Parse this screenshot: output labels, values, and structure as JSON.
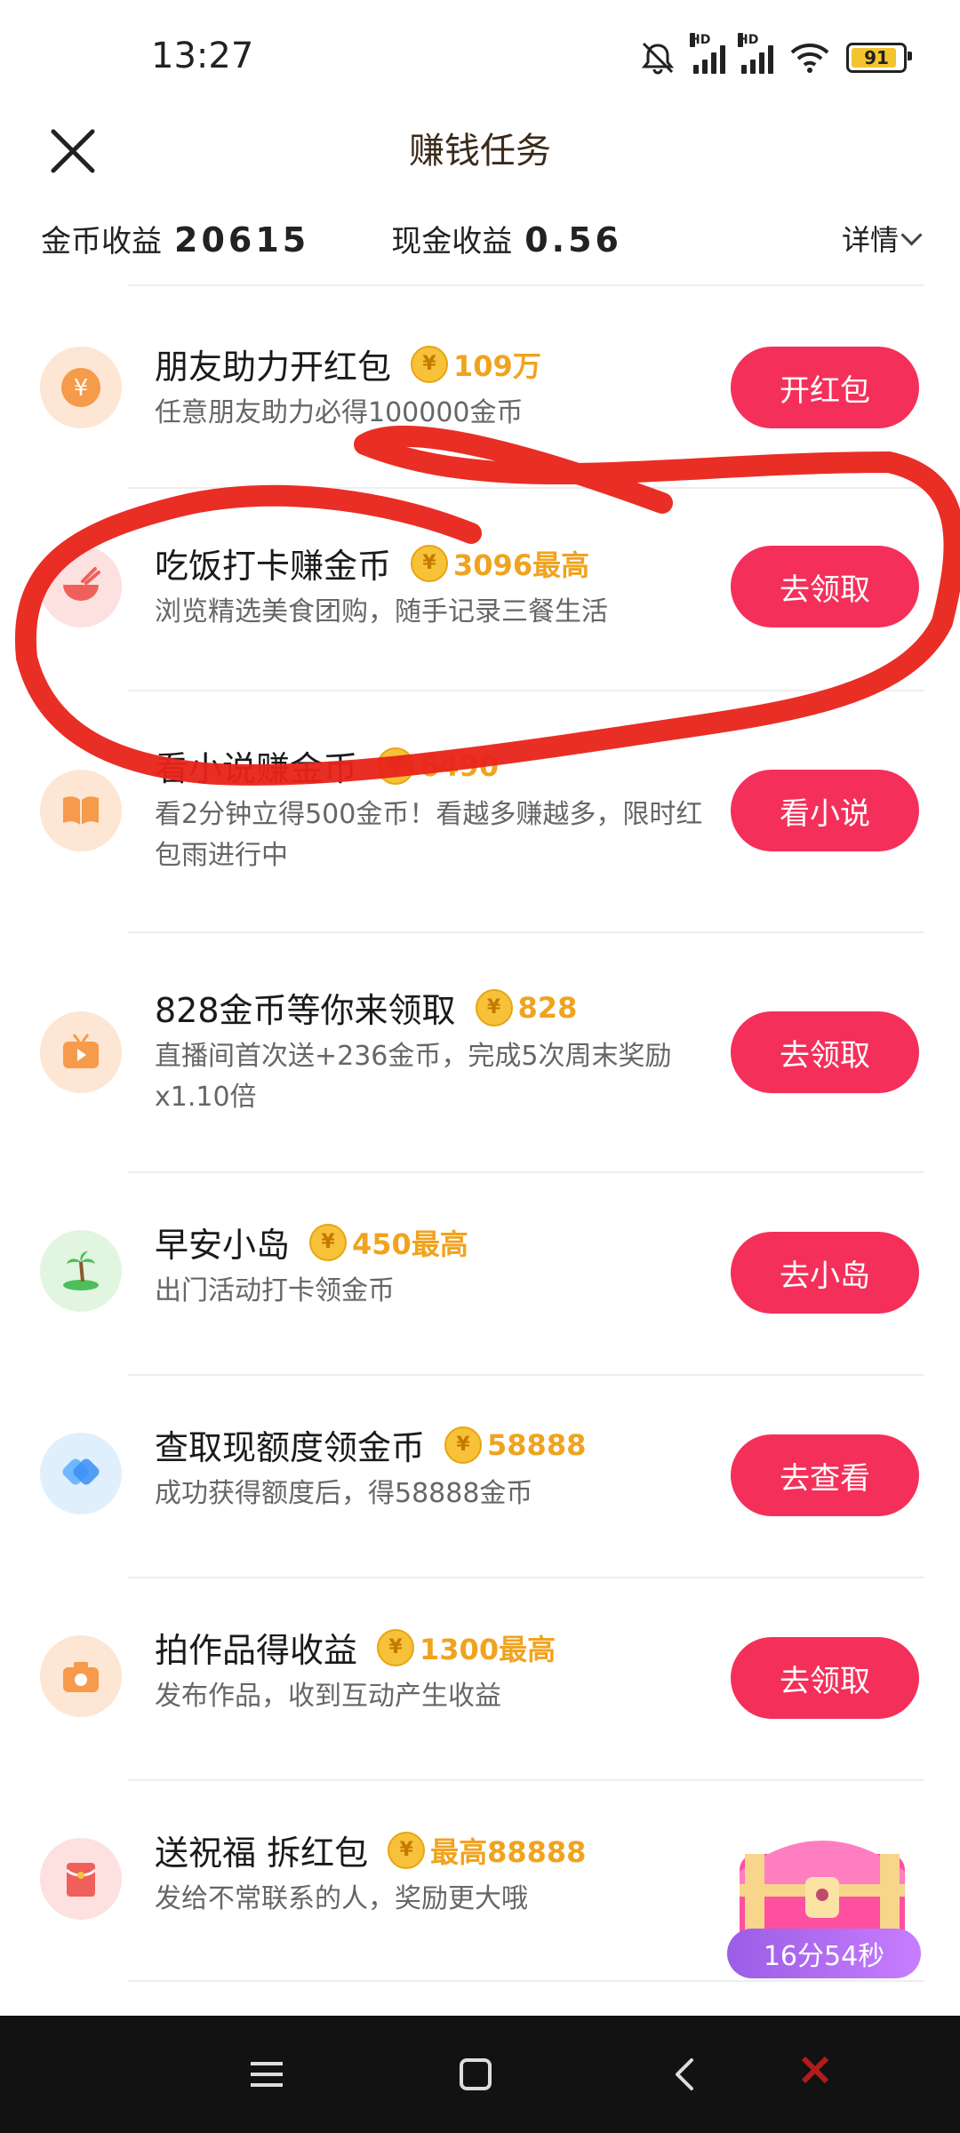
{
  "status": {
    "time": "13:27",
    "battery": "91",
    "hd1": "HD",
    "hd2": "HD"
  },
  "header": {
    "title": "赚钱任务"
  },
  "earnings": {
    "coin_label": "金币收益",
    "coin_value": "20615",
    "cash_label": "现金收益",
    "cash_value": "0.56",
    "details_label": "详情"
  },
  "tasks": [
    {
      "title": "朋友助力开红包",
      "reward": "109万",
      "desc": "任意朋友助力必得100000金币",
      "button": "开红包",
      "icon": "yuan-coin-icon",
      "icon_bg": "#fde6d3",
      "icon_color": "#f59b4b"
    },
    {
      "title": "吃饭打卡赚金币",
      "reward": "3096最高",
      "desc": "浏览精选美食团购，随手记录三餐生活",
      "button": "去领取",
      "icon": "rice-bowl-icon",
      "icon_bg": "#fde0e0",
      "icon_color": "#f0605a"
    },
    {
      "title": "看小说赚金币",
      "reward": "6490",
      "desc": "看2分钟立得500金币！看越多赚越多，限时红包雨进行中",
      "button": "看小说",
      "icon": "book-icon",
      "icon_bg": "#fde6d3",
      "icon_color": "#f59b4b"
    },
    {
      "title": "828金币等你来领取",
      "reward": "828",
      "desc": "直播间首次送+236金币，完成5次周末奖励x1.10倍",
      "button": "去领取",
      "icon": "tv-icon",
      "icon_bg": "#fde6d3",
      "icon_color": "#f59b4b"
    },
    {
      "title": "早安小岛",
      "reward": "450最高",
      "desc": "出门活动打卡领金币",
      "button": "去小岛",
      "icon": "island-icon",
      "icon_bg": "#e2f5e0",
      "icon_color": "#4cbf5a"
    },
    {
      "title": "查取现额度领金币",
      "reward": "58888",
      "desc": "成功获得额度后，得58888金币",
      "button": "去查看",
      "icon": "diamond-icon",
      "icon_bg": "#dff0fc",
      "icon_color": "#3b8ef5"
    },
    {
      "title": "拍作品得收益",
      "reward": "1300最高",
      "desc": "发布作品，收到互动产生收益",
      "button": "去领取",
      "icon": "camera-icon",
      "icon_bg": "#fde6d3",
      "icon_color": "#f59b4b"
    },
    {
      "title": "送祝福 拆红包",
      "reward": "最高88888",
      "desc": "发给不常联系的人，奖励更大哦",
      "button": "",
      "icon": "red-envelope-icon",
      "icon_bg": "#fde0e0",
      "icon_color": "#f0605a"
    }
  ],
  "chest": {
    "timer": "16分54秒"
  }
}
